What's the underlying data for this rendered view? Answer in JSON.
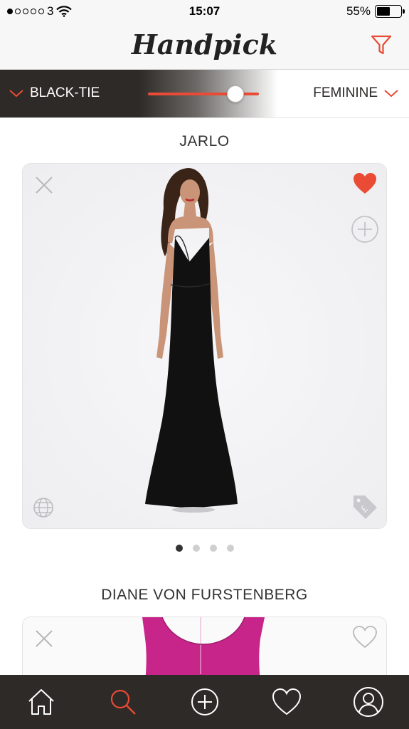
{
  "status_bar": {
    "carrier": "3",
    "time": "15:07",
    "battery": "55%",
    "battery_level": 0.55
  },
  "app": {
    "logo": "Handpick"
  },
  "filters": {
    "occasion": "BLACK-TIE",
    "style": "FEMININE",
    "slider_value": 0.8
  },
  "products": [
    {
      "brand": "JARLO",
      "favorited": true,
      "dress_color": "#111111"
    },
    {
      "brand": "DIANE VON FURSTENBERG",
      "favorited": false,
      "dress_color": "#c8258a"
    }
  ],
  "pagination": {
    "pages": 4,
    "current": 1
  },
  "tab_bar": {
    "items": [
      "home-icon",
      "search-icon",
      "add-icon",
      "heart-icon",
      "profile-icon"
    ],
    "active": "search-icon"
  },
  "colors": {
    "accent": "#e94b35",
    "dark": "#2e2a27"
  }
}
